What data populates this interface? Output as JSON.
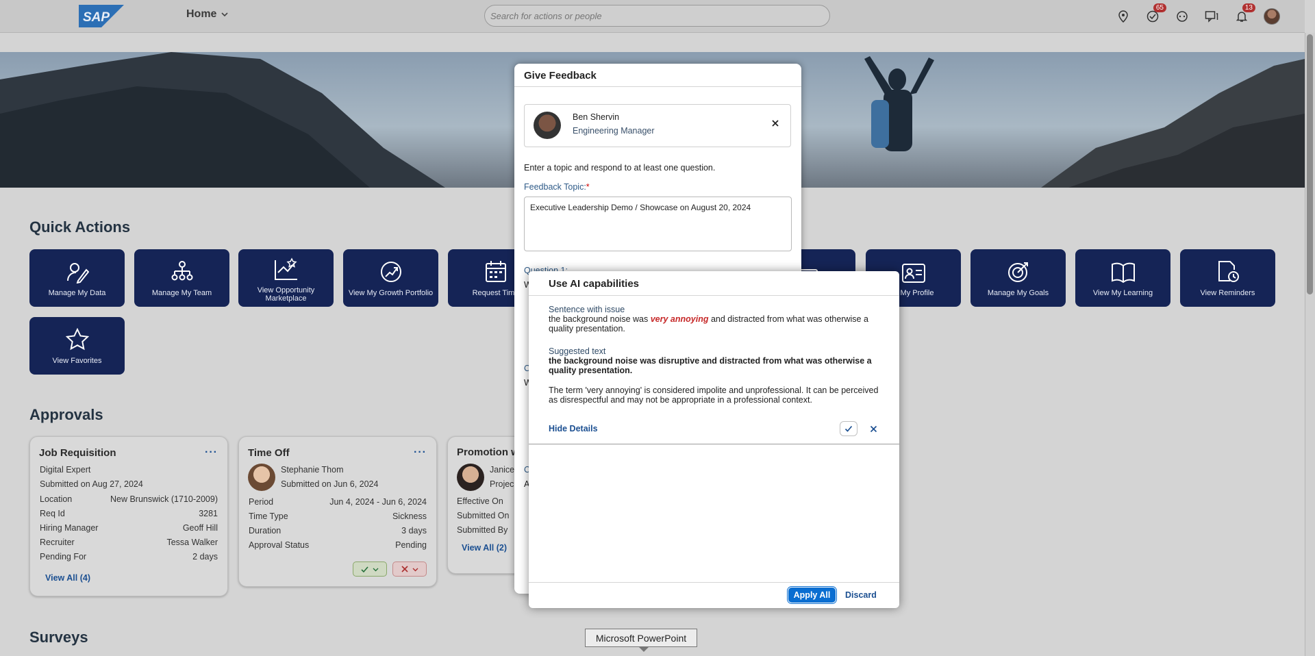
{
  "header": {
    "logo_text": "SAP",
    "home_label": "Home",
    "search_placeholder": "Search for actions or people",
    "tasks_badge": "65",
    "notifications_badge": "13"
  },
  "quick_actions": {
    "title": "Quick Actions",
    "tiles": [
      {
        "label": "Manage My Data"
      },
      {
        "label": "Manage My Team"
      },
      {
        "label": "View Opportunity Marketplace"
      },
      {
        "label": "View My Growth Portfolio"
      },
      {
        "label": "Request Time"
      },
      {
        "label": "w My Profile"
      },
      {
        "label": "Manage My Goals"
      },
      {
        "label": "View My Learning"
      },
      {
        "label": "View Reminders"
      },
      {
        "label": "View Favorites"
      }
    ]
  },
  "approvals": {
    "title": "Approvals",
    "job": {
      "title": "Job Requisition",
      "line1": "Digital Expert",
      "line2": "Submitted on Aug 27, 2024",
      "rows": [
        {
          "k": "Location",
          "v": "New Brunswick (1710-2009)"
        },
        {
          "k": "Req Id",
          "v": "3281"
        },
        {
          "k": "Hiring Manager",
          "v": "Geoff Hill"
        },
        {
          "k": "Recruiter",
          "v": "Tessa Walker"
        },
        {
          "k": "Pending For",
          "v": "2 days"
        }
      ],
      "link": "View All (4)"
    },
    "timeoff": {
      "title": "Time Off",
      "name": "Stephanie Thom",
      "submitted": "Submitted on Jun 6, 2024",
      "rows": [
        {
          "k": "Period",
          "v": "Jun 4, 2024 - Jun 6, 2024"
        },
        {
          "k": "Time Type",
          "v": "Sickness"
        },
        {
          "k": "Duration",
          "v": "3 days"
        },
        {
          "k": "Approval Status",
          "v": "Pending"
        }
      ]
    },
    "promotion": {
      "title": "Promotion w",
      "name": "Janice",
      "sub": "Projec",
      "rows": [
        "Effective On",
        "Submitted On",
        "Submitted By"
      ],
      "link": "View All (2)"
    }
  },
  "surveys": {
    "title": "Surveys"
  },
  "give_feedback": {
    "title": "Give Feedback",
    "person_name": "Ben Shervin",
    "person_role": "Engineering Manager",
    "instruction": "Enter a topic and respond to at least one question.",
    "topic_label": "Feedback Topic:",
    "required_mark": "*",
    "topic_value": "Executive Leadership Demo / Showcase on August 20, 2024",
    "question1_label": "Question 1:",
    "frag_w1": "W",
    "frag_c2": "C",
    "frag_w2": "W",
    "frag_c3": "C",
    "frag_a3": "A"
  },
  "ai_dialog": {
    "title": "Use AI capabilities",
    "issue_label": "Sentence with issue",
    "issue_before": "the background noise was ",
    "issue_highlight": "very annoying",
    "issue_after": " and distracted from what was otherwise a quality presentation.",
    "suggested_label": "Suggested text",
    "suggested_text": "the background noise was disruptive and distracted from what was otherwise a quality presentation.",
    "explanation": "The term 'very annoying' is considered impolite and unprofessional. It can be perceived as disrespectful and may not be appropriate in a professional context.",
    "hide_details": "Hide Details",
    "apply_all": "Apply All",
    "discard": "Discard"
  },
  "tooltip": {
    "text": "Microsoft PowerPoint"
  },
  "colors": {
    "tile_bg": "#152456",
    "link": "#1b4f91",
    "highlight": "#c62828",
    "primary_btn": "#0a6ed1"
  }
}
